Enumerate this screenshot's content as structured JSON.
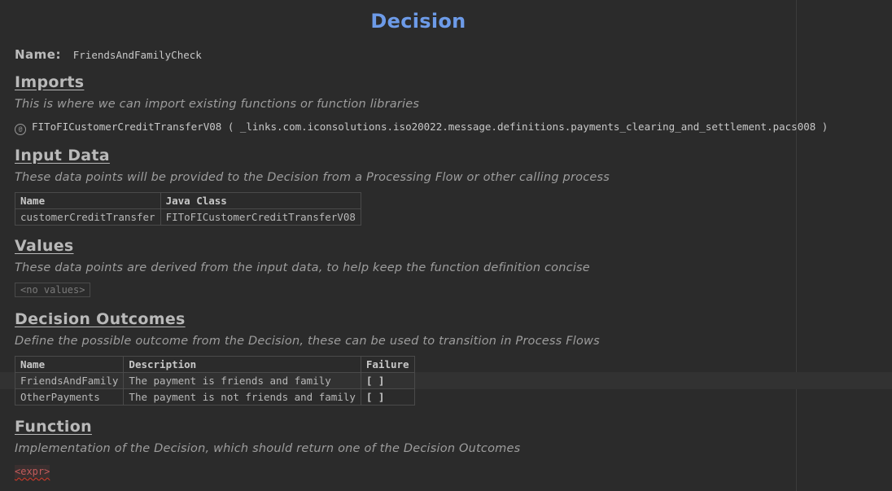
{
  "decision": {
    "title": "Decision",
    "name_label": "Name:",
    "name_value": "FriendsAndFamilyCheck"
  },
  "imports": {
    "header": "Imports",
    "description": "This is where we can import existing functions or function libraries",
    "icon": "@",
    "entry": "FIToFICustomerCreditTransferV08 ( _links.com.iconsolutions.iso20022.message.definitions.payments_clearing_and_settlement.pacs008 )"
  },
  "input_data": {
    "header": "Input Data",
    "description": "These data points will be provided to the Decision from a Processing Flow or other calling process",
    "columns": [
      "Name",
      "Java Class"
    ],
    "rows": [
      [
        "customerCreditTransfer",
        "FIToFICustomerCreditTransferV08"
      ]
    ]
  },
  "values": {
    "header": "Values",
    "description": "These data points are derived from the input data, to help keep the function definition concise",
    "placeholder": "<no values>"
  },
  "outcomes": {
    "header": "Decision Outcomes",
    "description": "Define the possible outcome from the Decision, these can be used to transition in Process Flows",
    "columns": [
      "Name",
      "Description",
      "Failure"
    ],
    "rows": [
      [
        "FriendsAndFamily",
        "The payment is friends and family",
        "[ ]"
      ],
      [
        "OtherPayments",
        "The payment is not friends and family",
        "[ ]"
      ]
    ]
  },
  "function": {
    "header": "Function",
    "description": "Implementation of the Decision, which should return one of the Decision Outcomes",
    "expr": "<expr>"
  }
}
